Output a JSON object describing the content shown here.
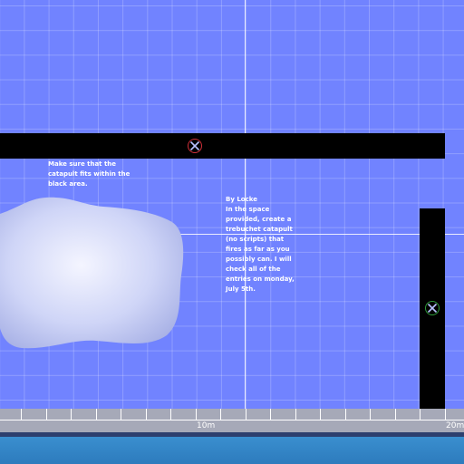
{
  "world": {
    "instructions_1": "Make sure that the\ncatapult fits within the\nblack area.",
    "instructions_2": "By Locke\nIn the space\nprovided, create a\ntrebuchet catapult\n(no scripts) that\nfires as far as you\npossibly can. I will\ncheck all of the\nentries on monday,\nJuly 5th.",
    "colors": {
      "sky": "#7183ff",
      "build_area": "#000000",
      "water": "#2d7bbd",
      "ruler": "#a6a9b8"
    },
    "markers": [
      {
        "icon": "pivot-x-marker-red",
        "color": "#d0303a"
      },
      {
        "icon": "pivot-x-marker-green",
        "color": "#2e9a3a"
      }
    ]
  },
  "ruler": {
    "label_10": "10m",
    "label_20": "20m"
  }
}
